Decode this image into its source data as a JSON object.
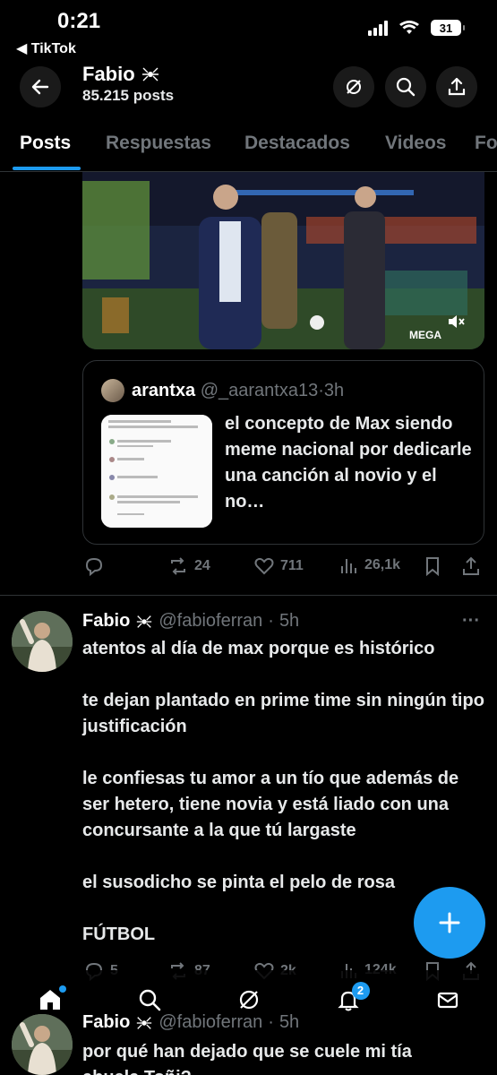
{
  "status_bar": {
    "time": "0:21",
    "back_app": "◀ TikTok",
    "battery": "31"
  },
  "header": {
    "name": "Fabio",
    "posts_count": "85.215 posts"
  },
  "tabs": [
    "Posts",
    "Respuestas",
    "Destacados",
    "Videos",
    "Fo"
  ],
  "quote": {
    "name": "arantxa",
    "handle": "@_aarantxa13",
    "time": "3h",
    "text": "el concepto de Max siendo meme nacional por dedicarle una canción al novio y el no…"
  },
  "first_post_actions": {
    "replies": "",
    "reposts": "24",
    "likes": "711",
    "views": "26,1k"
  },
  "post": {
    "name": "Fabio",
    "handle": "@fabioferran",
    "time": "5h",
    "paragraphs": [
      "atentos al día de max porque es histórico",
      "te dejan plantado en prime time sin ningún tipo justificación",
      "le confiesas tu amor a un tío que además de ser hetero, tiene novia y está liado con una concursante a la que tú largaste",
      "el susodicho se pinta el pelo de rosa",
      "FÚTBOL"
    ],
    "actions": {
      "replies": "5",
      "reposts": "87",
      "likes": "2k",
      "views": "124k"
    }
  },
  "next_post": {
    "name": "Fabio",
    "handle": "@fabioferran",
    "time": "5h",
    "text_line1": "por qué han dejado que se cuele mi tía",
    "text_line2": "abuela Toñi?"
  },
  "nav": {
    "notifications_badge": "2"
  },
  "colors": {
    "accent": "#1d9bf0",
    "muted": "#71767b",
    "bg": "#000000"
  }
}
